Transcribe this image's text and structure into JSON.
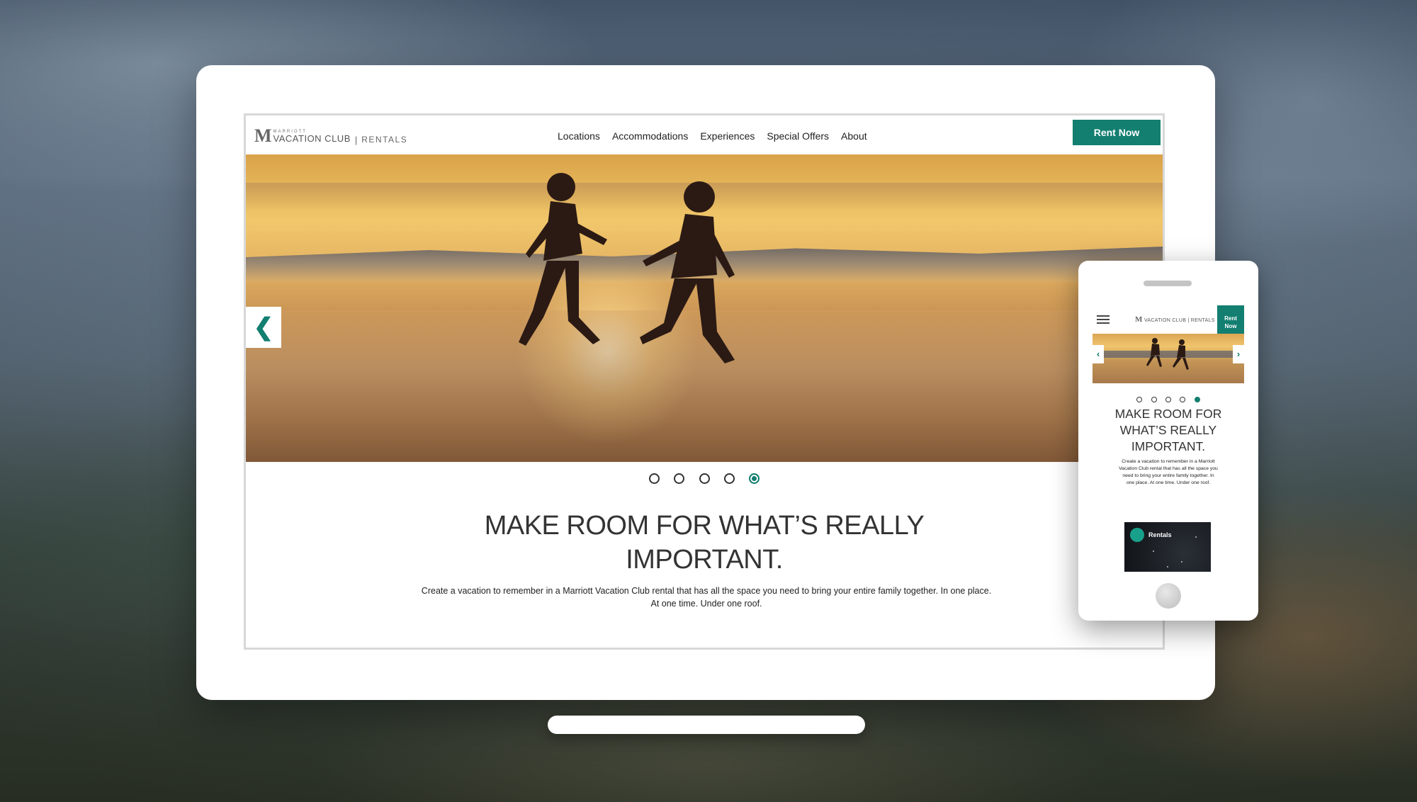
{
  "site": {
    "logo": {
      "small": "MARRIOTT",
      "main": "VACATION CLUB",
      "divider": "|",
      "sub": "RENTALS"
    },
    "nav": [
      "Locations",
      "Accommodations",
      "Experiences",
      "Special Offers",
      "About"
    ],
    "cta": "Rent Now",
    "hero": {
      "prev_arrow": "❮",
      "slides_total": 5,
      "active_slide": 5
    },
    "headline_line1": "MAKE ROOM FOR WHAT’S REALLY",
    "headline_line2": "IMPORTANT.",
    "description_line1": "Create a vacation to remember in a Marriott Vacation Club rental that has all the space you need to bring your entire family together. In one place.",
    "description_line2": "At one time. Under one roof."
  },
  "mobile": {
    "logo": "VACATION CLUB | RENTALS",
    "cta_line1": "Rent",
    "cta_line2": "Now",
    "prev_arrow": "‹",
    "next_arrow": "›",
    "headline_line1": "MAKE ROOM FOR",
    "headline_line2": "WHAT’S REALLY",
    "headline_line3": "IMPORTANT.",
    "description_line1": "Create a vacation to remember in a Marriott",
    "description_line2": "Vacation Club rental that has all the space you",
    "description_line3": "need to bring your entire family together. In",
    "description_line4": "one place. At one time. Under one roof.",
    "card_label": "Rentals"
  },
  "colors": {
    "accent": "#137f70"
  }
}
